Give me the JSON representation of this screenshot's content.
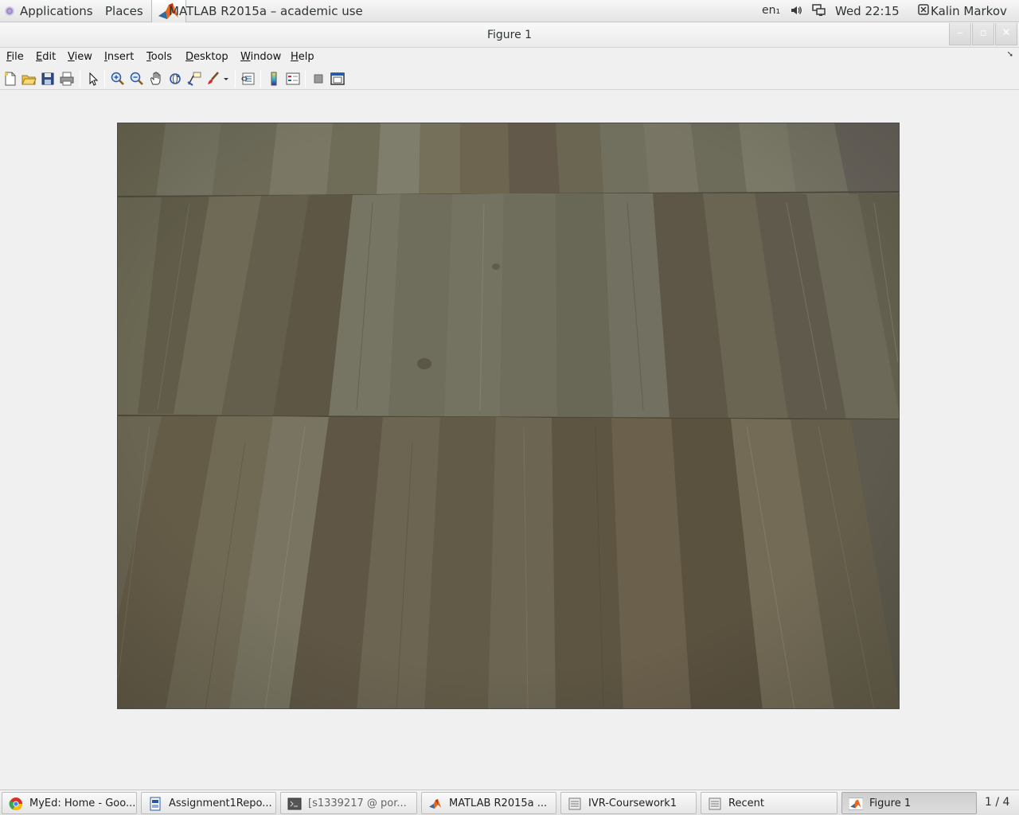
{
  "topbar": {
    "applications": "Applications",
    "places": "Places",
    "active_window": "MATLAB R2015a – academic use",
    "keyboard_layout": "en₁",
    "clock": "Wed 22:15",
    "user": "Kalin Markov"
  },
  "window": {
    "title": "Figure 1",
    "minimize": "–",
    "maximize": "▫",
    "close": "✕"
  },
  "menubar": {
    "items": [
      {
        "label": "File",
        "mnemonic": "F"
      },
      {
        "label": "Edit",
        "mnemonic": "E"
      },
      {
        "label": "View",
        "mnemonic": "V"
      },
      {
        "label": "Insert",
        "mnemonic": "I"
      },
      {
        "label": "Tools",
        "mnemonic": "T"
      },
      {
        "label": "Desktop",
        "mnemonic": "D"
      },
      {
        "label": "Window",
        "mnemonic": "W"
      },
      {
        "label": "Help",
        "mnemonic": "H"
      }
    ]
  },
  "toolbar": {
    "icons": [
      "new-figure-icon",
      "open-file-icon",
      "save-figure-icon",
      "print-figure-icon",
      "edit-plot-icon",
      "zoom-in-icon",
      "zoom-out-icon",
      "pan-icon",
      "rotate-3d-icon",
      "data-cursor-icon",
      "brush-icon",
      "brush-dropdown-icon",
      "link-plot-icon",
      "insert-colorbar-icon",
      "insert-legend-icon",
      "hide-plot-tools-icon",
      "show-plot-tools-icon"
    ]
  },
  "figure": {
    "content": "wooden floor photograph",
    "colors": {
      "wood_base": "#6f6854",
      "wood_dark": "#5c5140",
      "wood_light": "#878270"
    }
  },
  "taskbar": {
    "tasks": [
      {
        "label": "MyEd: Home - Goo...",
        "icon": "chrome-icon",
        "dim": false
      },
      {
        "label": "Assignment1Repo...",
        "icon": "document-icon",
        "dim": false
      },
      {
        "label": "[s1339217 @ por...",
        "icon": "terminal-icon",
        "dim": true
      },
      {
        "label": "MATLAB R2015a ...",
        "icon": "matlab-icon",
        "dim": false
      },
      {
        "label": "IVR-Coursework1",
        "icon": "file-manager-icon",
        "dim": false
      },
      {
        "label": "Recent",
        "icon": "file-manager-icon",
        "dim": false
      },
      {
        "label": "Figure 1",
        "icon": "matlab-icon",
        "dim": false,
        "active": true
      }
    ],
    "pager": "1 / 4"
  }
}
